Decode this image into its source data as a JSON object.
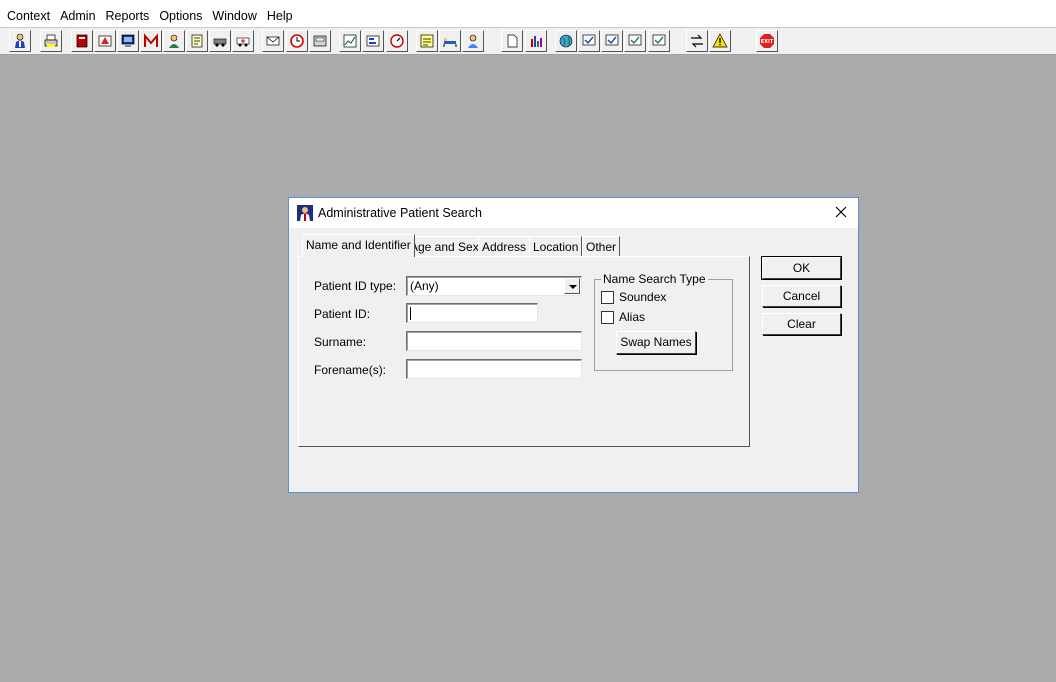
{
  "menubar": {
    "items": [
      "Context",
      "Admin",
      "Reports",
      "Options",
      "Window",
      "Help"
    ]
  },
  "toolbar": {
    "icons": [
      "patient-icon",
      "printer-icon",
      "book-icon",
      "flag-icon",
      "monitor-icon",
      "m-icon",
      "person-icon",
      "notepad-icon",
      "car-icon",
      "ambulance-icon",
      "mail-icon",
      "clock-icon",
      "panel-icon",
      "chart-icon",
      "form-icon",
      "gauge-icon",
      "note-icon",
      "bed-icon",
      "nurse-icon",
      "document-icon",
      "bar-chart-icon",
      "globe-icon",
      "checklist-icon",
      "checklist-2-icon",
      "checklist-3-icon",
      "checklist-4-icon",
      "transfer-icon",
      "warning-icon",
      "exit-icon"
    ],
    "exit_label": "EXIT"
  },
  "dialog": {
    "title": "Administrative Patient Search",
    "tabs": [
      "Name and Identifier",
      "Age and Sex",
      "Address",
      "Location",
      "Other"
    ],
    "fields": {
      "id_type_label": "Patient ID type:",
      "id_type_value": "(Any)",
      "patient_id_label": "Patient ID:",
      "patient_id_value": "",
      "surname_label": "Surname:",
      "surname_value": "",
      "forename_label": "Forename(s):",
      "forename_value": ""
    },
    "name_search": {
      "legend": "Name Search Type",
      "soundex_label": "Soundex",
      "soundex_checked": false,
      "alias_label": "Alias",
      "alias_checked": false,
      "swap_label": "Swap Names"
    },
    "buttons": {
      "ok": "OK",
      "cancel": "Cancel",
      "clear": "Clear"
    }
  },
  "colors": {
    "desktop": "#ababab",
    "dialog_border": "#5a8fd0",
    "exit_red": "#e02020"
  }
}
